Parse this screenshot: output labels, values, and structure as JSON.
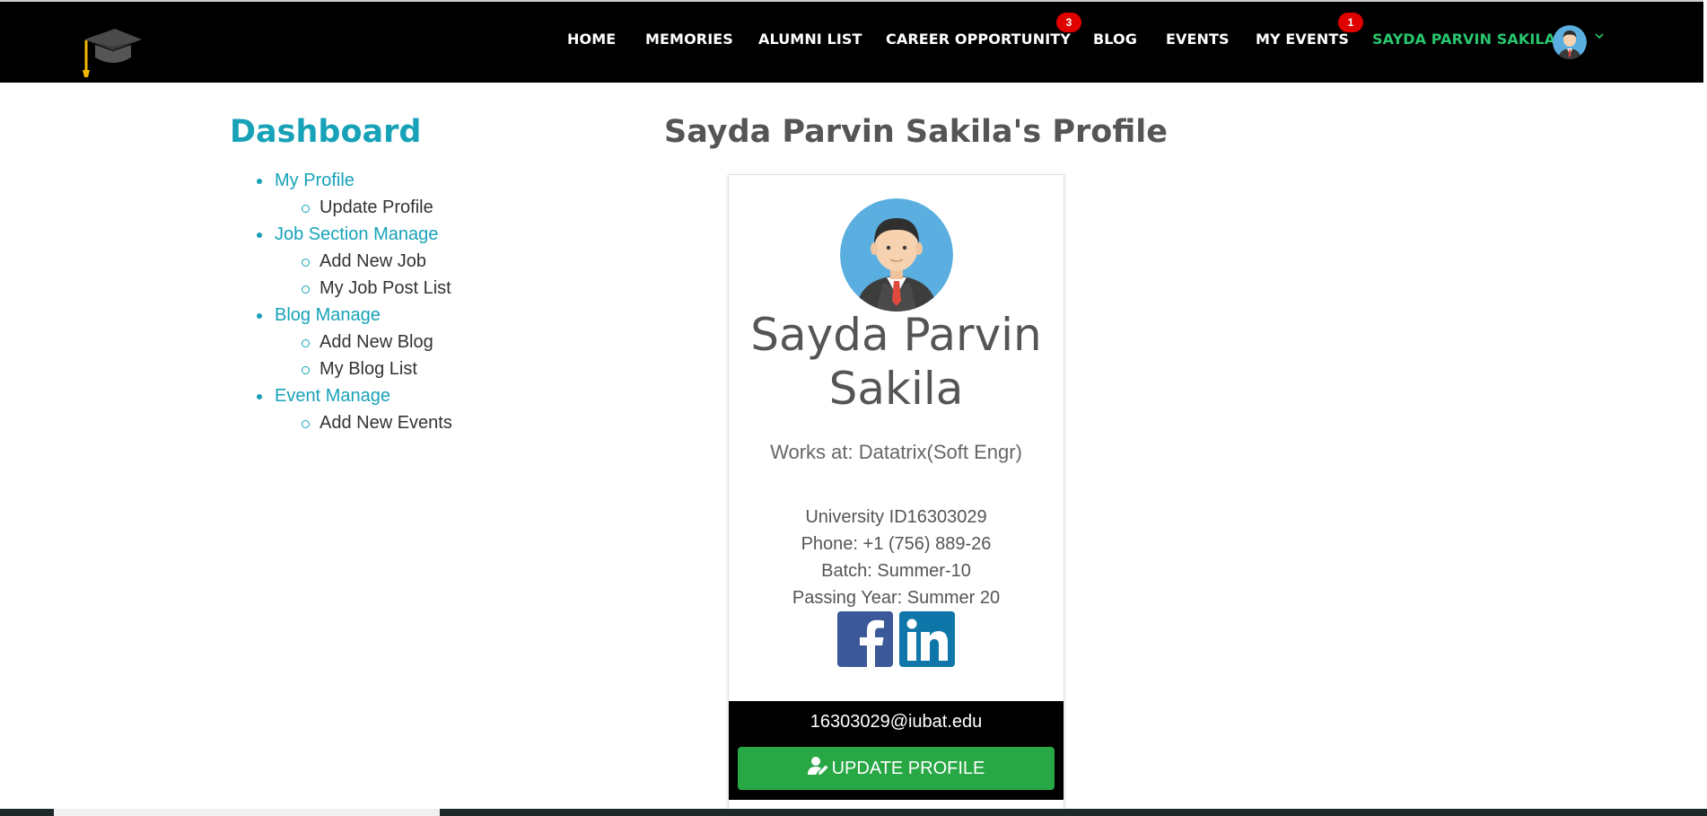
{
  "nav": {
    "items": [
      "HOME",
      "MEMORIES",
      "ALUMNI LIST",
      "CAREER OPPORTUNITY",
      "BLOG",
      "EVENTS",
      "MY EVENTS"
    ],
    "career_badge": "3",
    "events_badge": "1",
    "user_name": "SAYDA PARVIN SAKILA"
  },
  "sidebar": {
    "title": "Dashboard",
    "menu": [
      {
        "label": "My Profile",
        "children": [
          "Update Profile"
        ]
      },
      {
        "label": "Job Section Manage",
        "children": [
          "Add New Job",
          "My Job Post List"
        ]
      },
      {
        "label": "Blog Manage",
        "children": [
          "Add New Blog",
          "My Blog List"
        ]
      },
      {
        "label": "Event Manage",
        "children": [
          "Add New Events"
        ]
      }
    ]
  },
  "profile": {
    "title": "Sayda Parvin Sakila's Profile",
    "name_line1": "Sayda Parvin",
    "name_line2": "Sakila",
    "works_at": "Works at: Datatrix(Soft Engr)",
    "university_id": "University ID16303029",
    "phone": "Phone: +1 (756) 889-26",
    "batch": "Batch: Summer-10",
    "passing_year": "Passing Year: Summer 20",
    "email": "16303029@iubat.edu",
    "update_button": "UPDATE PROFILE"
  },
  "colors": {
    "accent": "#17a2b8",
    "user_green": "#28c76f",
    "button_green": "#28a745",
    "badge_red": "#e00000"
  },
  "icons": [
    "graduation-cap-icon",
    "facebook-icon",
    "linkedin-icon",
    "user-edit-icon",
    "chevron-down-icon"
  ]
}
